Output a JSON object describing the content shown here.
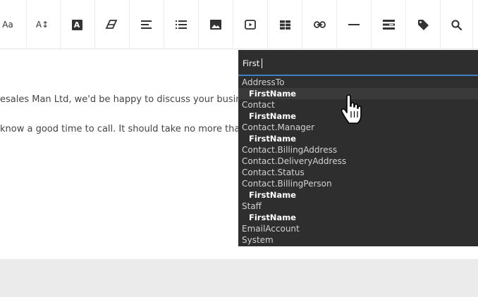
{
  "toolbar": {
    "buttons": [
      {
        "name": "font-size-button",
        "label": "Aa"
      },
      {
        "name": "line-height-button",
        "label": "A↕"
      },
      {
        "name": "text-color-button",
        "label": "A"
      },
      {
        "name": "clear-format-button",
        "label": ""
      },
      {
        "name": "align-button",
        "label": ""
      },
      {
        "name": "list-button",
        "label": ""
      },
      {
        "name": "insert-image-button",
        "label": ""
      },
      {
        "name": "insert-video-button",
        "label": ""
      },
      {
        "name": "insert-table-button",
        "label": ""
      },
      {
        "name": "insert-link-button",
        "label": ""
      },
      {
        "name": "horizontal-rule-button",
        "label": ""
      },
      {
        "name": "insert-field-button",
        "label": ""
      },
      {
        "name": "tag-button",
        "label": ""
      },
      {
        "name": "search-button",
        "label": ""
      }
    ]
  },
  "editor": {
    "line1": "esales Man Ltd, we'd be happy to discuss your busin",
    "line2": "know a good time to call. It should take no more tha"
  },
  "dropdown": {
    "search_value": "First",
    "items": [
      {
        "label": "AddressTo",
        "child": false
      },
      {
        "label": "FirstName",
        "child": true
      },
      {
        "label": "Contact",
        "child": false
      },
      {
        "label": "FirstName",
        "child": true
      },
      {
        "label": "Contact.Manager",
        "child": false
      },
      {
        "label": "FirstName",
        "child": true
      },
      {
        "label": "Contact.BillingAddress",
        "child": false
      },
      {
        "label": "Contact.DeliveryAddress",
        "child": false
      },
      {
        "label": "Contact.Status",
        "child": false
      },
      {
        "label": "Contact.BillingPerson",
        "child": false
      },
      {
        "label": "FirstName",
        "child": true
      },
      {
        "label": "Staff",
        "child": false
      },
      {
        "label": "FirstName",
        "child": true
      },
      {
        "label": "EmailAccount",
        "child": false
      },
      {
        "label": "System",
        "child": false
      }
    ]
  },
  "colors": {
    "dropdown_bg": "#2e2e2e",
    "accent": "#3b7fc4"
  }
}
